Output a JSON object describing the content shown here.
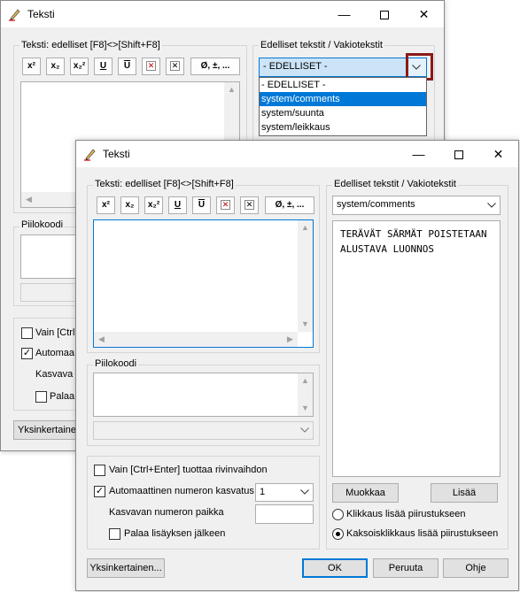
{
  "colors": {
    "selection": "#0078d7",
    "accent_border": "#0078d7",
    "highlight_box": "#8b1a1a",
    "dialog_bg": "#f0f0f0"
  },
  "back": {
    "title": "Teksti",
    "text_group_label": "Teksti:  edelliset [F8]<>[Shift+F8]",
    "prev_group_label": "Edelliset tekstit / Vakiotekstit",
    "combo_value": "- EDELLISET -",
    "dropdown_items": [
      "- EDELLISET -",
      "system/comments",
      "system/suunta",
      "system/leikkaus"
    ],
    "dropdown_selected_index": 1,
    "piilokoodi_label": "Piilokoodi",
    "only_ctrl_enter_partial": "Vain [Ctrl",
    "auto_numbering_partial": "Automaa",
    "increment_pos_partial": "Kasvava",
    "return_partial": "Palaa",
    "simplified_partial": "Yksinkertaine"
  },
  "front": {
    "title": "Teksti",
    "text_group_label": "Teksti:  edelliset [F8]<>[Shift+F8]",
    "prev_group_label": "Edelliset tekstit / Vakiotekstit",
    "toolbar": {
      "superscript_label": "x²",
      "subscript_label": "x₂",
      "supsub_label": "x₂²",
      "underline_label": "U",
      "overline_label": "U",
      "special_label": "Ø, ±, ..."
    },
    "category_combo_value": "system/comments",
    "preset_lines": [
      "TERÄVÄT SÄRMÄT POISTETAAN",
      "ALUSTAVA LUONNOS"
    ],
    "edit_button": "Muokkaa",
    "add_button": "Lisää",
    "radio_click": "Klikkaus lisää piirustukseen",
    "radio_double_click": "Kaksoisklikkaus lisää piirustukseen",
    "radio_selected": "double_click",
    "piilokoodi_label": "Piilokoodi",
    "only_ctrl_enter_label": "Vain [Ctrl+Enter] tuottaa rivinvaihdon",
    "only_ctrl_enter_checked": false,
    "auto_numbering_label": "Automaattinen numeron kasvatus",
    "auto_numbering_checked": true,
    "auto_numbering_value": "1",
    "increment_pos_label": "Kasvavan numeron paikka",
    "increment_pos_value": "",
    "return_label": "Palaa lisäyksen jälkeen",
    "return_checked": false,
    "simplified_button": "Yksinkertainen...",
    "ok_button": "OK",
    "cancel_button": "Peruuta",
    "help_button": "Ohje"
  }
}
